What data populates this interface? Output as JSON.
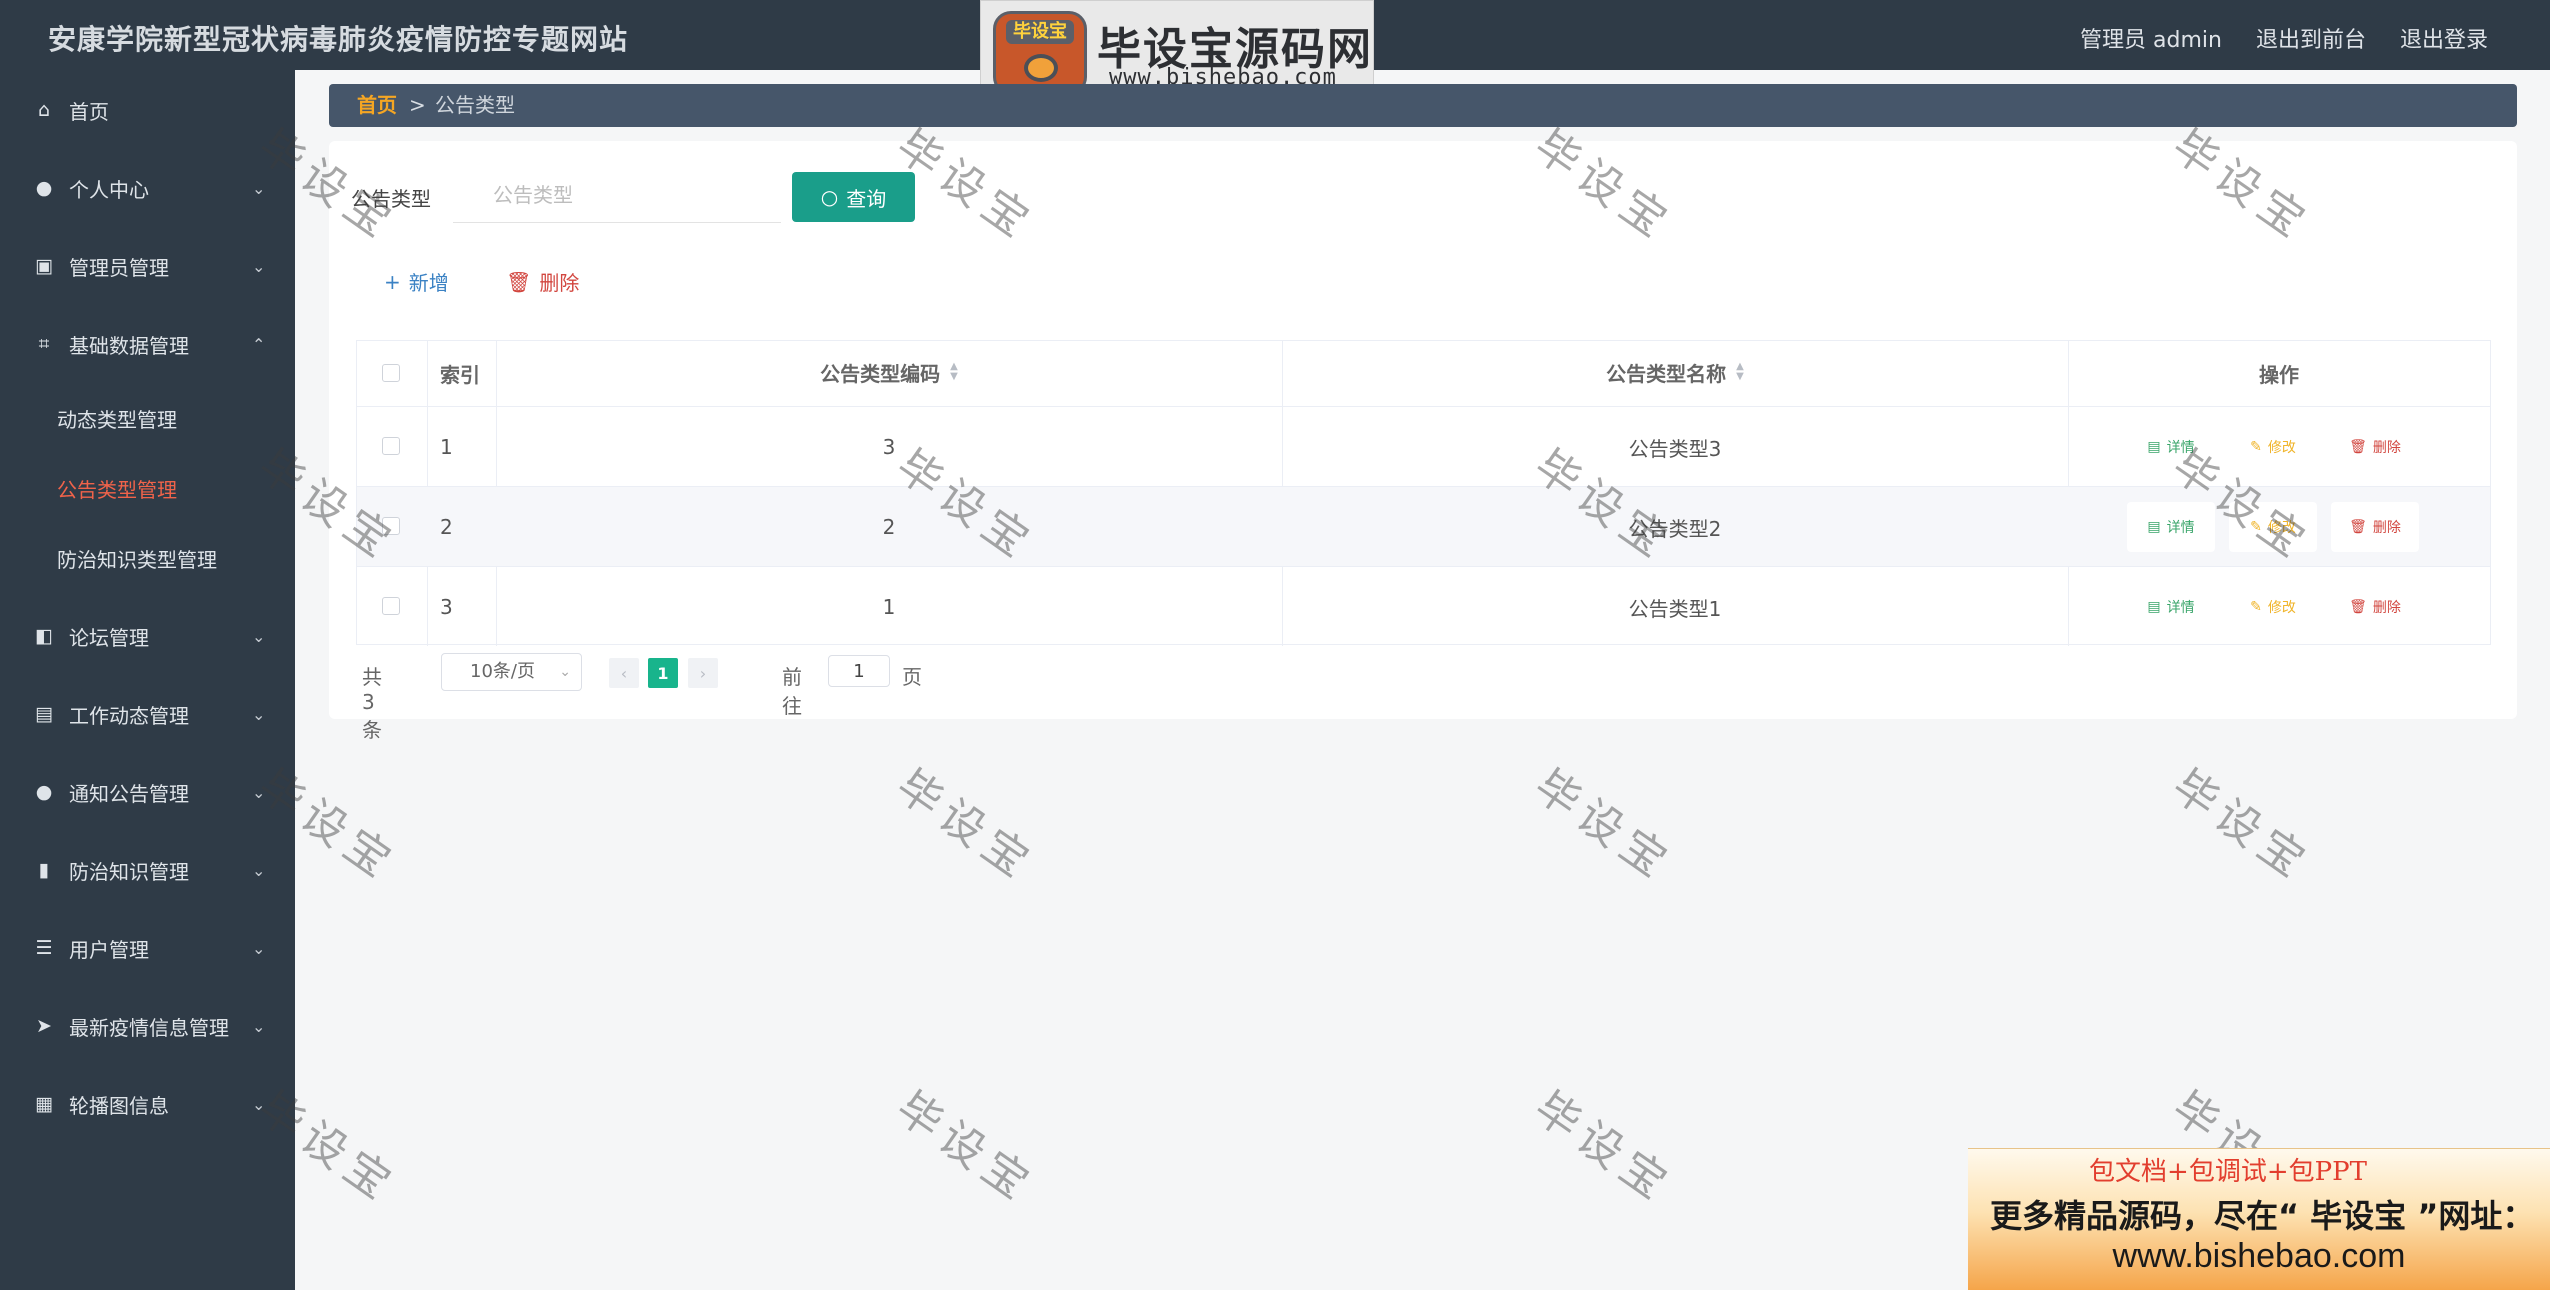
{
  "app": {
    "title": "安康学院新型冠状病毒肺炎疫情防控专题网站",
    "user_label": "管理员 admin",
    "back_to_front": "退出到前台",
    "logout": "退出登录"
  },
  "brand": {
    "badge": "毕设宝",
    "name": "毕设宝源码网",
    "url": "www.bishebao.com"
  },
  "sidebar": {
    "items": [
      {
        "label": "首页",
        "icon": "home-icon"
      },
      {
        "label": "个人中心",
        "icon": "user-icon"
      },
      {
        "label": "管理员管理",
        "icon": "clipboard-icon"
      },
      {
        "label": "基础数据管理",
        "icon": "crop-icon"
      },
      {
        "label": "论坛管理",
        "icon": "forum-icon"
      },
      {
        "label": "工作动态管理",
        "icon": "briefcase-icon"
      },
      {
        "label": "通知公告管理",
        "icon": "user-icon"
      },
      {
        "label": "防治知识管理",
        "icon": "bar-chart-icon"
      },
      {
        "label": "用户管理",
        "icon": "list-icon"
      },
      {
        "label": "最新疫情信息管理",
        "icon": "send-icon"
      },
      {
        "label": "轮播图信息",
        "icon": "grid-icon"
      }
    ],
    "submenu": [
      {
        "label": "动态类型管理"
      },
      {
        "label": "公告类型管理"
      },
      {
        "label": "防治知识类型管理"
      }
    ]
  },
  "breadcrumb": {
    "home": "首页",
    "separator": ">",
    "current": "公告类型"
  },
  "search": {
    "label": "公告类型",
    "placeholder": "公告类型",
    "button": "查询"
  },
  "actions": {
    "add": "新增",
    "delete": "删除"
  },
  "table": {
    "headers": {
      "index": "索引",
      "code": "公告类型编码",
      "name": "公告类型名称",
      "ops": "操作"
    },
    "rows": [
      {
        "index": "1",
        "code": "3",
        "name": "公告类型3"
      },
      {
        "index": "2",
        "code": "2",
        "name": "公告类型2"
      },
      {
        "index": "3",
        "code": "1",
        "name": "公告类型1"
      }
    ],
    "ops": {
      "detail": "详情",
      "edit": "修改",
      "delete": "删除"
    }
  },
  "pager": {
    "total": "共 3 条",
    "page_size": "10条/页",
    "current_page": "1",
    "goto_label": "前往",
    "goto_value": "1",
    "goto_suffix": "页"
  },
  "watermark": "毕设宝",
  "promo": {
    "line1": "包文档+包调试+包PPT",
    "line2": "更多精品源码，尽在“ 毕设宝 ”网址：",
    "line3": "www.bishebao.com"
  },
  "colors": {
    "sidebar_bg": "#2f3b47",
    "active_menu": "#f0634a",
    "query_button": "#1a9e8a",
    "page_active": "#18b48c"
  }
}
